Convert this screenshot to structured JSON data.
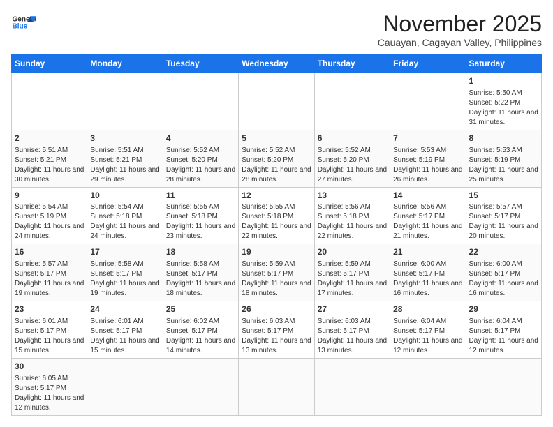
{
  "header": {
    "logo_line1": "General",
    "logo_line2": "Blue",
    "title": "November 2025",
    "subtitle": "Cauayan, Cagayan Valley, Philippines"
  },
  "days_of_week": [
    "Sunday",
    "Monday",
    "Tuesday",
    "Wednesday",
    "Thursday",
    "Friday",
    "Saturday"
  ],
  "weeks": [
    [
      {
        "day": "",
        "info": ""
      },
      {
        "day": "",
        "info": ""
      },
      {
        "day": "",
        "info": ""
      },
      {
        "day": "",
        "info": ""
      },
      {
        "day": "",
        "info": ""
      },
      {
        "day": "",
        "info": ""
      },
      {
        "day": "1",
        "info": "Sunrise: 5:50 AM\nSunset: 5:22 PM\nDaylight: 11 hours and 31 minutes."
      }
    ],
    [
      {
        "day": "2",
        "info": "Sunrise: 5:51 AM\nSunset: 5:21 PM\nDaylight: 11 hours and 30 minutes."
      },
      {
        "day": "3",
        "info": "Sunrise: 5:51 AM\nSunset: 5:21 PM\nDaylight: 11 hours and 29 minutes."
      },
      {
        "day": "4",
        "info": "Sunrise: 5:52 AM\nSunset: 5:20 PM\nDaylight: 11 hours and 28 minutes."
      },
      {
        "day": "5",
        "info": "Sunrise: 5:52 AM\nSunset: 5:20 PM\nDaylight: 11 hours and 28 minutes."
      },
      {
        "day": "6",
        "info": "Sunrise: 5:52 AM\nSunset: 5:20 PM\nDaylight: 11 hours and 27 minutes."
      },
      {
        "day": "7",
        "info": "Sunrise: 5:53 AM\nSunset: 5:19 PM\nDaylight: 11 hours and 26 minutes."
      },
      {
        "day": "8",
        "info": "Sunrise: 5:53 AM\nSunset: 5:19 PM\nDaylight: 11 hours and 25 minutes."
      }
    ],
    [
      {
        "day": "9",
        "info": "Sunrise: 5:54 AM\nSunset: 5:19 PM\nDaylight: 11 hours and 24 minutes."
      },
      {
        "day": "10",
        "info": "Sunrise: 5:54 AM\nSunset: 5:18 PM\nDaylight: 11 hours and 24 minutes."
      },
      {
        "day": "11",
        "info": "Sunrise: 5:55 AM\nSunset: 5:18 PM\nDaylight: 11 hours and 23 minutes."
      },
      {
        "day": "12",
        "info": "Sunrise: 5:55 AM\nSunset: 5:18 PM\nDaylight: 11 hours and 22 minutes."
      },
      {
        "day": "13",
        "info": "Sunrise: 5:56 AM\nSunset: 5:18 PM\nDaylight: 11 hours and 22 minutes."
      },
      {
        "day": "14",
        "info": "Sunrise: 5:56 AM\nSunset: 5:17 PM\nDaylight: 11 hours and 21 minutes."
      },
      {
        "day": "15",
        "info": "Sunrise: 5:57 AM\nSunset: 5:17 PM\nDaylight: 11 hours and 20 minutes."
      }
    ],
    [
      {
        "day": "16",
        "info": "Sunrise: 5:57 AM\nSunset: 5:17 PM\nDaylight: 11 hours and 19 minutes."
      },
      {
        "day": "17",
        "info": "Sunrise: 5:58 AM\nSunset: 5:17 PM\nDaylight: 11 hours and 19 minutes."
      },
      {
        "day": "18",
        "info": "Sunrise: 5:58 AM\nSunset: 5:17 PM\nDaylight: 11 hours and 18 minutes."
      },
      {
        "day": "19",
        "info": "Sunrise: 5:59 AM\nSunset: 5:17 PM\nDaylight: 11 hours and 18 minutes."
      },
      {
        "day": "20",
        "info": "Sunrise: 5:59 AM\nSunset: 5:17 PM\nDaylight: 11 hours and 17 minutes."
      },
      {
        "day": "21",
        "info": "Sunrise: 6:00 AM\nSunset: 5:17 PM\nDaylight: 11 hours and 16 minutes."
      },
      {
        "day": "22",
        "info": "Sunrise: 6:00 AM\nSunset: 5:17 PM\nDaylight: 11 hours and 16 minutes."
      }
    ],
    [
      {
        "day": "23",
        "info": "Sunrise: 6:01 AM\nSunset: 5:17 PM\nDaylight: 11 hours and 15 minutes."
      },
      {
        "day": "24",
        "info": "Sunrise: 6:01 AM\nSunset: 5:17 PM\nDaylight: 11 hours and 15 minutes."
      },
      {
        "day": "25",
        "info": "Sunrise: 6:02 AM\nSunset: 5:17 PM\nDaylight: 11 hours and 14 minutes."
      },
      {
        "day": "26",
        "info": "Sunrise: 6:03 AM\nSunset: 5:17 PM\nDaylight: 11 hours and 13 minutes."
      },
      {
        "day": "27",
        "info": "Sunrise: 6:03 AM\nSunset: 5:17 PM\nDaylight: 11 hours and 13 minutes."
      },
      {
        "day": "28",
        "info": "Sunrise: 6:04 AM\nSunset: 5:17 PM\nDaylight: 11 hours and 12 minutes."
      },
      {
        "day": "29",
        "info": "Sunrise: 6:04 AM\nSunset: 5:17 PM\nDaylight: 11 hours and 12 minutes."
      }
    ],
    [
      {
        "day": "30",
        "info": "Sunrise: 6:05 AM\nSunset: 5:17 PM\nDaylight: 11 hours and 12 minutes."
      },
      {
        "day": "",
        "info": ""
      },
      {
        "day": "",
        "info": ""
      },
      {
        "day": "",
        "info": ""
      },
      {
        "day": "",
        "info": ""
      },
      {
        "day": "",
        "info": ""
      },
      {
        "day": "",
        "info": ""
      }
    ]
  ]
}
